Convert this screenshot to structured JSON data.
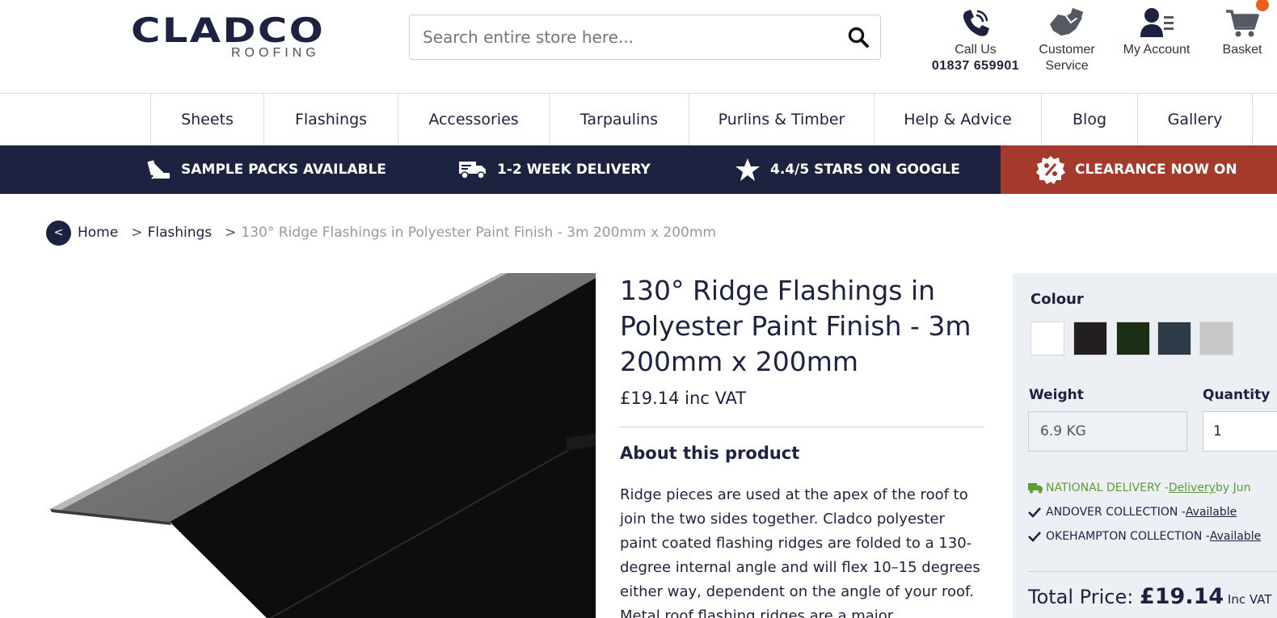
{
  "header": {
    "logo_main": "CLADCO",
    "logo_sub": "ROOFING",
    "search_placeholder": "Search entire store here...",
    "call_label": "Call Us",
    "call_number": "01837 659901",
    "customer_service_line1": "Customer",
    "customer_service_line2": "Service",
    "account_label": "My Account",
    "basket_label": "Basket"
  },
  "nav": {
    "items": [
      "Sheets",
      "Flashings",
      "Accessories",
      "Tarpaulins",
      "Purlins & Timber",
      "Help & Advice",
      "Blog",
      "Gallery"
    ]
  },
  "usp": {
    "samples": "SAMPLE PACKS AVAILABLE",
    "delivery": "1-2 WEEK DELIVERY",
    "stars": "4.4/5 STARS ON GOOGLE",
    "clearance": "CLEARANCE NOW ON"
  },
  "breadcrumb": {
    "back": "<",
    "home": "Home",
    "sep": ">",
    "category": "Flashings",
    "current": "130° Ridge Flashings in Polyester Paint Finish - 3m 200mm x 200mm"
  },
  "product": {
    "title": "130° Ridge Flashings in Polyester Paint Finish - 3m 200mm x 200mm",
    "price": "£19.14 inc VAT",
    "about_heading": "About this product",
    "about_text": "Ridge pieces are used at the apex of the roof to join the two sides together. Cladco polyester paint coated flashing ridges are folded to a 130-degree internal angle and will flex 10–15 degrees either way, dependent on the angle of your roof. Metal roof flashing ridges are a major"
  },
  "panel": {
    "colour_label": "Colour",
    "swatches": [
      "#ffffff",
      "#231f20",
      "#1c2e14",
      "#2e3a48",
      "#c8c8c8"
    ],
    "weight_label": "Weight",
    "weight_value": "6.9 KG",
    "quantity_label": "Quantity",
    "quantity_value": "1",
    "national_prefix": "NATIONAL DELIVERY - ",
    "national_link": "Delivery",
    "national_suffix": " by Jun",
    "andover_prefix": "ANDOVER COLLECTION - ",
    "andover_link": "Available",
    "okehampton_prefix": "OKEHAMPTON COLLECTION - ",
    "okehampton_link": "Available",
    "total_label": "Total Price: ",
    "total_value": "£19.14",
    "total_suffix": " Inc VAT"
  },
  "colors": {
    "navy": "#1d2240",
    "clearance_red": "#a43a2c",
    "delivery_green": "#5f9a34",
    "panel_bg": "#ecf0f4"
  }
}
